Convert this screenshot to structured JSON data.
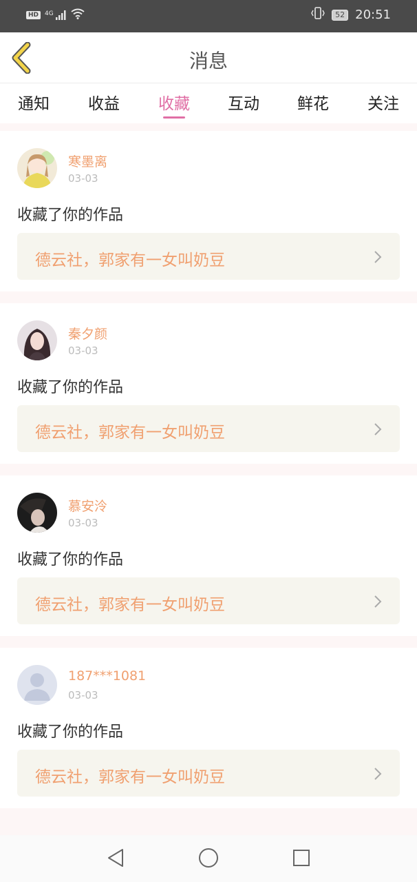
{
  "status_bar": {
    "left_icons": [
      "hd-icon",
      "signal-4g-icon",
      "wifi-icon"
    ],
    "hd": "HD",
    "network": "4G",
    "battery": "52",
    "time": "20:51"
  },
  "header": {
    "title": "消息"
  },
  "tabs": [
    {
      "label": "通知",
      "active": false
    },
    {
      "label": "收益",
      "active": false
    },
    {
      "label": "收藏",
      "active": true
    },
    {
      "label": "互动",
      "active": false
    },
    {
      "label": "鲜花",
      "active": false
    },
    {
      "label": "关注",
      "active": false
    }
  ],
  "colors": {
    "accent": "#e06fa5",
    "username": "#f0a070",
    "link_bg": "#f6f5ee"
  },
  "messages": [
    {
      "user": "寒墨离",
      "date": "03-03",
      "text": "收藏了你的作品",
      "work": "德云社，郭家有一女叫奶豆"
    },
    {
      "user": "秦夕颜",
      "date": "03-03",
      "text": "收藏了你的作品",
      "work": "德云社，郭家有一女叫奶豆"
    },
    {
      "user": "慕安泠",
      "date": "03-03",
      "text": "收藏了你的作品",
      "work": "德云社，郭家有一女叫奶豆"
    },
    {
      "user": "187***1081",
      "date": "03-03",
      "text": "收藏了你的作品",
      "work": "德云社，郭家有一女叫奶豆"
    }
  ]
}
